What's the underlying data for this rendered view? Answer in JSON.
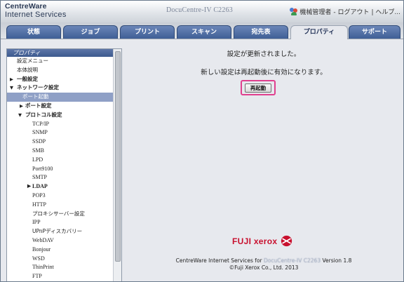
{
  "header": {
    "brand_line1": "CentreWare",
    "brand_line2": "Internet Services",
    "device": "DocuCentre-IV C2263",
    "user": "機械管理者",
    "logout": "- ログアウト",
    "help": "| ヘルプ..."
  },
  "tabs": [
    {
      "label": "状態"
    },
    {
      "label": "ジョブ"
    },
    {
      "label": "プリント"
    },
    {
      "label": "スキャン"
    },
    {
      "label": "宛先表"
    },
    {
      "label": "プロパティ"
    },
    {
      "label": "サポート"
    }
  ],
  "active_tab": "プロパティ",
  "sidebar": {
    "header": "プロパティ",
    "items": [
      {
        "label": "設定メニュー"
      },
      {
        "label": "本体説明"
      },
      {
        "label": "一般設定"
      },
      {
        "label": "ネットワーク設定"
      },
      {
        "label": "ポート起動"
      },
      {
        "label": "ポート設定"
      },
      {
        "label": "プロトコル設定"
      },
      {
        "label": "TCP/IP"
      },
      {
        "label": "SNMP"
      },
      {
        "label": "SSDP"
      },
      {
        "label": "SMB"
      },
      {
        "label": "LPD"
      },
      {
        "label": "Port9100"
      },
      {
        "label": "SMTP"
      },
      {
        "label": "LDAP"
      },
      {
        "label": "POP3"
      },
      {
        "label": "HTTP"
      },
      {
        "label": "プロキシサーバー設定"
      },
      {
        "label": "IPP"
      },
      {
        "label": "UPnPディスカバリー"
      },
      {
        "label": "WebDAV"
      },
      {
        "label": "Bonjour"
      },
      {
        "label": "WSD"
      },
      {
        "label": "ThinPrint"
      },
      {
        "label": "FTP"
      }
    ],
    "selected": "ポート起動"
  },
  "main": {
    "message1": "設定が更新されました。",
    "message2": "新しい設定は再起動後に有効になります。",
    "restart_button": "再起動"
  },
  "logo": {
    "text": "FUJI xerox"
  },
  "footer": {
    "line1_prefix": "CentreWare Internet Services for",
    "line1_device": "DocuCentre-IV C2263",
    "line1_suffix": "Version 1.8",
    "line2": "©Fuji Xerox Co., Ltd. 2013"
  },
  "colors": {
    "tab": "#3f5f96",
    "highlight": "#e0408e",
    "logo_red": "#c8102e",
    "selected_item": "#8fa0c6"
  }
}
